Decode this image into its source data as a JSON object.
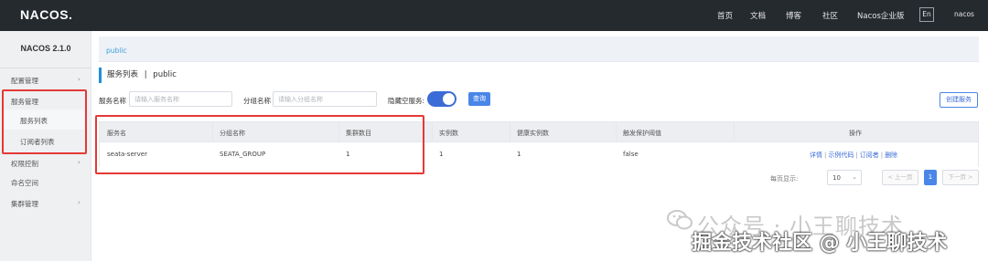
{
  "topbar": {
    "logo": "NACOS.",
    "nav": [
      "首页",
      "文档",
      "博客",
      "社区",
      "Nacos企业版"
    ],
    "lang": "En",
    "user": "nacos"
  },
  "sidebar": {
    "version": "NACOS 2.1.0",
    "items": [
      {
        "label": "配置管理"
      },
      {
        "label": "服务管理"
      },
      {
        "label": "服务列表"
      },
      {
        "label": "订阅者列表"
      },
      {
        "label": "权限控制"
      },
      {
        "label": "命名空间"
      },
      {
        "label": "集群管理"
      }
    ]
  },
  "breadcrumb": "public",
  "page": {
    "title": "服务列表",
    "sep": "|",
    "namespace": "public"
  },
  "filters": {
    "service_label": "服务名称",
    "service_placeholder": "请输入服务名称",
    "group_label": "分组名称",
    "group_placeholder": "请输入分组名称",
    "hide_empty_label": "隐藏空服务:",
    "hide_empty_on": true,
    "query_btn": "查询",
    "create_btn": "创建服务"
  },
  "table": {
    "headers": [
      "服务名",
      "分组名称",
      "集群数目",
      "实例数",
      "健康实例数",
      "触发保护阈值",
      "操作"
    ],
    "rows": [
      {
        "service": "seata-server",
        "group": "SEATA_GROUP",
        "clusters": "1",
        "instances": "1",
        "healthy": "1",
        "threshold": "false",
        "ops": [
          "详情",
          "示例代码",
          "订阅者",
          "删除"
        ]
      }
    ]
  },
  "pager": {
    "per_page_label": "每页显示:",
    "per_page": "10",
    "prev": "< 上一页",
    "current": "1",
    "next": "下一页 >"
  },
  "watermark": {
    "line1": "公众号 · 小王聊技术",
    "line2": "掘金技术社区 @ 小王聊技术"
  },
  "colors": {
    "topbar": "#252a2f",
    "accent": "#4a86e8",
    "annotation": "#e53935"
  }
}
